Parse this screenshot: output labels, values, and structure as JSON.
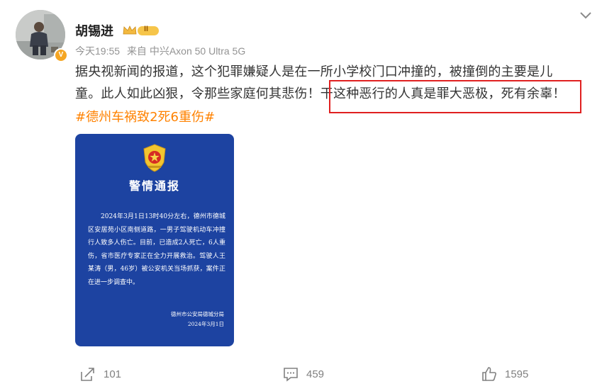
{
  "user": {
    "name": "胡锡进",
    "vip_level": "II",
    "avatar_badge": "V"
  },
  "meta": {
    "time": "今天19:55",
    "source": "来自 中兴Axon 50 Ultra 5G"
  },
  "post": {
    "line1": "据央视新闻的报道，这个犯罪嫌疑人是在一所小学校门口冲撞的，被撞倒的主要是儿",
    "line2": "童。此人如此凶狠，令那些家庭何其悲伤！干这种恶行的人真是罪大恶极，死有余辜！",
    "hashtag": "#德州车祸致2死6重伤#"
  },
  "notice": {
    "title": "警情通报",
    "body": "2024年3月1日13时40分左右，德州市德城区安居苑小区南侧道路，一男子驾驶机动车冲撞行人致多人伤亡。目前，已造成2人死亡，6人重伤，省市医疗专家正在全力开展救治。驾驶人王某涛（男，46岁）被公安机关当场抓获，案件正在进一步调查中。",
    "issuer": "德州市公安局德城分局",
    "date": "2024年3月1日"
  },
  "actions": {
    "share_count": "101",
    "comment_count": "459",
    "like_count": "1595"
  },
  "icons": {
    "collapse": "chevron-down-icon",
    "share": "share-icon",
    "comment": "comment-icon",
    "like": "thumbs-up-icon"
  },
  "colors": {
    "hashtag": "#ff8200",
    "highlight_border": "#e02020",
    "notice_bg": "#1d43a1",
    "vip_gold": "#f3b93f"
  }
}
